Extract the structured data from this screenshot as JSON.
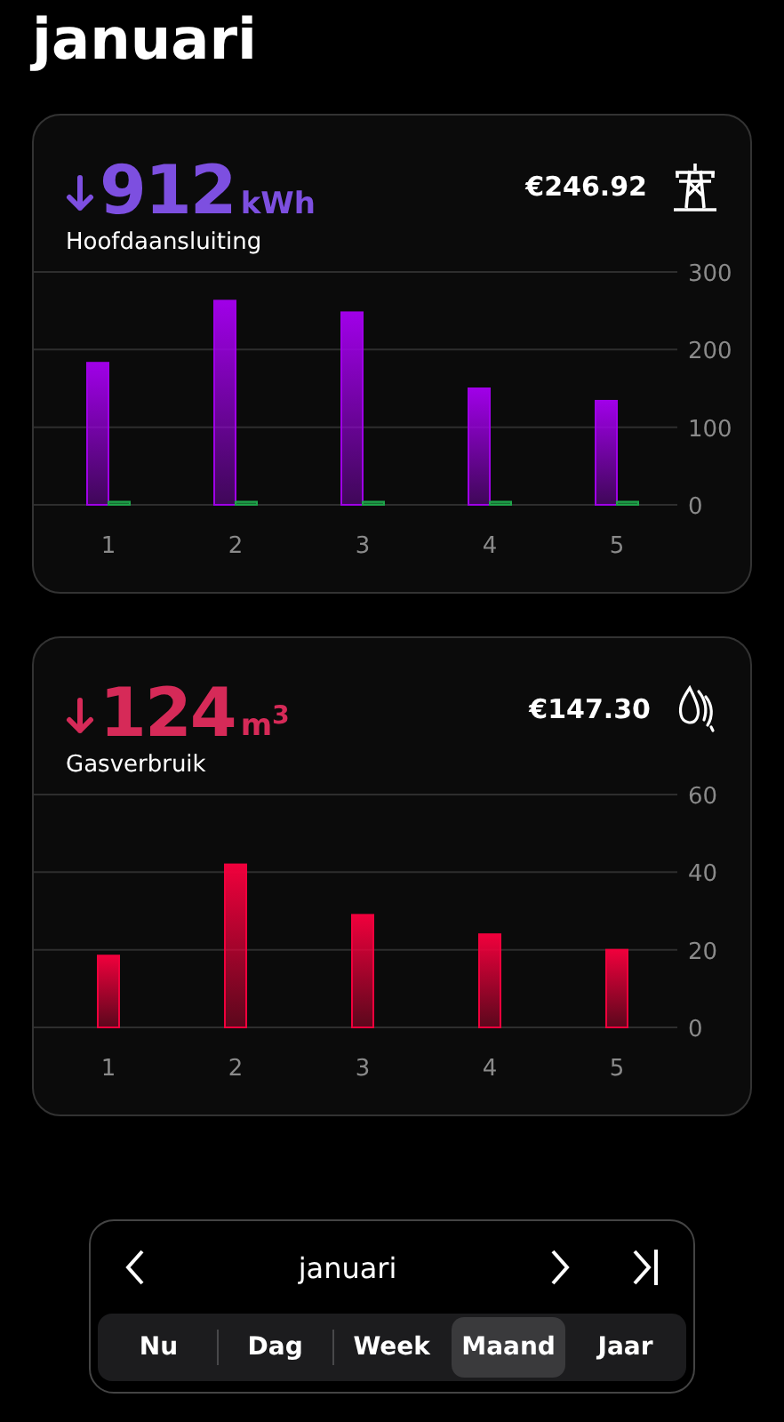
{
  "header": {
    "title": "januari"
  },
  "cards": [
    {
      "kind": "electricity",
      "color": "#7d4fe0",
      "value": "912",
      "unit": "kWh",
      "label": "Hoofdaansluiting",
      "cost": "€246.92",
      "chart_data": {
        "type": "bar",
        "categories": [
          "1",
          "2",
          "3",
          "4",
          "5"
        ],
        "series": [
          {
            "color": "#a000e8",
            "values": [
              183,
              263,
              248,
              150,
              134
            ]
          },
          {
            "color": "#1fa34a",
            "values": [
              4,
              4,
              4,
              4,
              4
            ]
          }
        ],
        "ylim": [
          0,
          300
        ],
        "yticks": [
          0,
          100,
          200,
          300
        ]
      }
    },
    {
      "kind": "gas",
      "color": "#d62a58",
      "value": "124",
      "unit": "m$^{3}$",
      "label": "Gasverbruik",
      "cost": "€147.30",
      "chart_data": {
        "type": "bar",
        "categories": [
          "1",
          "2",
          "3",
          "4",
          "5"
        ],
        "series": [
          {
            "color": "#f0003c",
            "values": [
              18.5,
              42,
              29,
              24,
              20
            ]
          }
        ],
        "ylim": [
          0,
          60
        ],
        "yticks": [
          0,
          20,
          40,
          60
        ]
      }
    }
  ],
  "period_nav": {
    "label": "januari",
    "segments": [
      {
        "label": "Nu",
        "selected": false
      },
      {
        "label": "Dag",
        "selected": false
      },
      {
        "label": "Week",
        "selected": false
      },
      {
        "label": "Maand",
        "selected": true
      },
      {
        "label": "Jaar",
        "selected": false
      }
    ]
  }
}
